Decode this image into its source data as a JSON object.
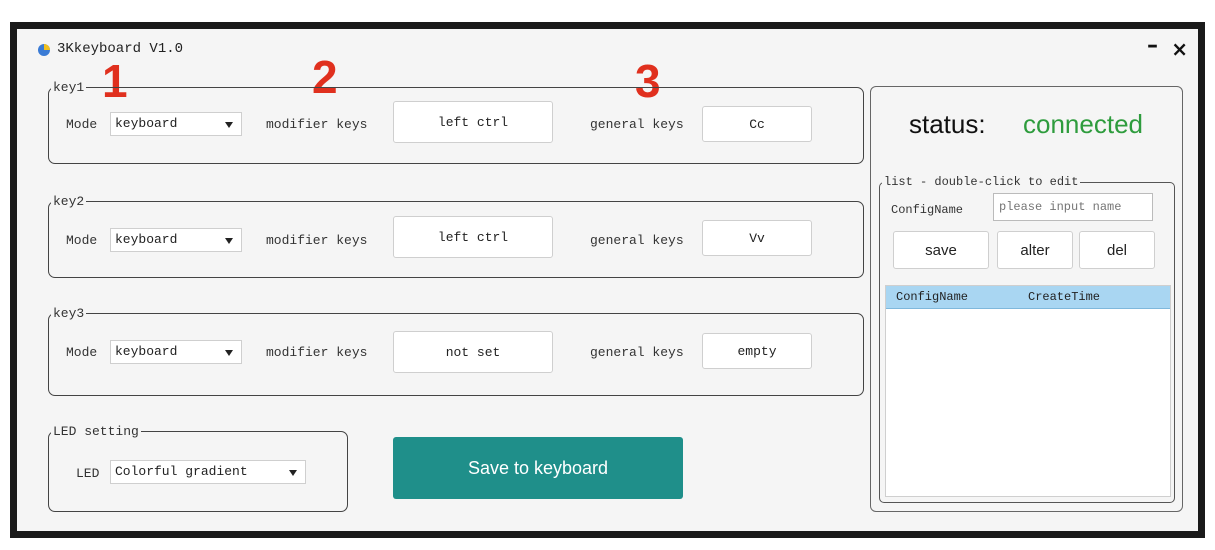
{
  "window": {
    "title": "3Kkeyboard V1.0",
    "minimize": "–",
    "close": "×"
  },
  "annotations": [
    "1",
    "2",
    "3"
  ],
  "keys": [
    {
      "legend": "key1",
      "mode_label": "Mode",
      "mode_value": "keyboard",
      "modifier_label": "modifier keys",
      "modifier_value": "left ctrl",
      "general_label": "general keys",
      "general_value": "Cc"
    },
    {
      "legend": "key2",
      "mode_label": "Mode",
      "mode_value": "keyboard",
      "modifier_label": "modifier keys",
      "modifier_value": "left ctrl",
      "general_label": "general keys",
      "general_value": "Vv"
    },
    {
      "legend": "key3",
      "mode_label": "Mode",
      "mode_value": "keyboard",
      "modifier_label": "modifier keys",
      "modifier_value": "not set",
      "general_label": "general keys",
      "general_value": "empty"
    }
  ],
  "led": {
    "legend": "LED setting",
    "label": "LED",
    "value": "Colorful gradient"
  },
  "save_button": "Save to keyboard",
  "status": {
    "label": "status:",
    "value": "connected",
    "value_color": "#2e9c3d"
  },
  "list": {
    "legend": "list - double-click to edit",
    "config_label": "ConfigName",
    "config_placeholder": "please input name",
    "buttons": {
      "save": "save",
      "alter": "alter",
      "del": "del"
    },
    "columns": [
      "ConfigName",
      "CreateTime"
    ]
  },
  "colors": {
    "accent_button": "#1f8f8a",
    "annotation": "#e0301e",
    "table_header": "#a9d6f2"
  }
}
